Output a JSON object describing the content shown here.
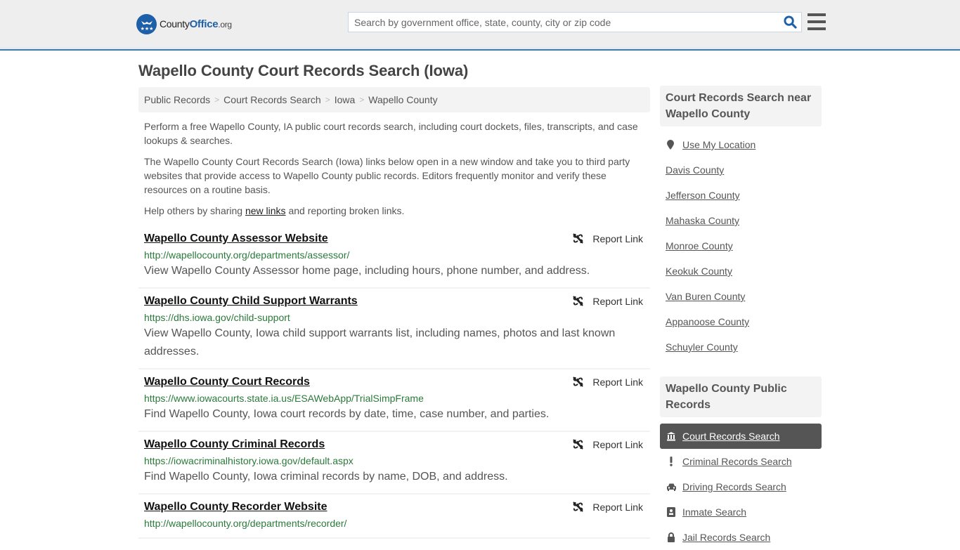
{
  "header": {
    "logo": {
      "name": "County",
      "brand": "Office",
      "tld": ".org"
    },
    "search": {
      "placeholder": "Search by government office, state, county, city or zip code",
      "value": ""
    },
    "icons": {
      "search": "search-icon",
      "menu": "hamburger-menu-icon"
    }
  },
  "page": {
    "title": "Wapello County Court Records Search (Iowa)"
  },
  "breadcrumb": [
    {
      "label": "Public Records"
    },
    {
      "label": "Court Records Search"
    },
    {
      "label": "Iowa"
    },
    {
      "label": "Wapello County"
    }
  ],
  "breadcrumb_separator": ">",
  "intro": {
    "p1": "Perform a free Wapello County, IA public court records search, including court dockets, files, transcripts, and case lookups & searches.",
    "p2": "The Wapello County Court Records Search (Iowa) links below open in a new window and take you to third party websites that provide access to Wapello County public records. Editors frequently monitor and verify these resources on a routine basis.",
    "p3_before": "Help others by sharing ",
    "p3_link": "new links",
    "p3_after": " and reporting broken links."
  },
  "links": [
    {
      "title": "Wapello County Assessor Website",
      "url": "http://wapellocounty.org/departments/assessor/",
      "description": "View Wapello County Assessor home page, including hours, phone number, and address.",
      "report_label": "Report Link"
    },
    {
      "title": "Wapello County Child Support Warrants",
      "url": "https://dhs.iowa.gov/child-support",
      "description": "View Wapello County, Iowa child support warrants list, including names, photos and last known addresses.",
      "report_label": "Report Link"
    },
    {
      "title": "Wapello County Court Records",
      "url": "https://www.iowacourts.state.ia.us/ESAWebApp/TrialSimpFrame",
      "description": "Find Wapello County, Iowa court records by date, time, case number, and parties.",
      "report_label": "Report Link"
    },
    {
      "title": "Wapello County Criminal Records",
      "url": "https://iowacriminalhistory.iowa.gov/default.aspx",
      "description": "Find Wapello County, Iowa criminal records by name, DOB, and address.",
      "report_label": "Report Link"
    },
    {
      "title": "Wapello County Recorder Website",
      "url": "http://wapellocounty.org/departments/recorder/",
      "description": "",
      "report_label": "Report Link"
    }
  ],
  "sidebar": {
    "nearby": {
      "heading": "Court Records Search near Wapello County",
      "use_location": "Use My Location",
      "counties": [
        "Davis County",
        "Jefferson County",
        "Mahaska County",
        "Monroe County",
        "Keokuk County",
        "Van Buren County",
        "Appanoose County",
        "Schuyler County"
      ]
    },
    "public_records": {
      "heading": "Wapello County Public Records",
      "items": [
        {
          "label": "Court Records Search",
          "icon": "courthouse-icon",
          "active": true
        },
        {
          "label": "Criminal Records Search",
          "icon": "exclamation-icon",
          "active": false
        },
        {
          "label": "Driving Records Search",
          "icon": "car-icon",
          "active": false
        },
        {
          "label": "Inmate Search",
          "icon": "id-badge-icon",
          "active": false
        },
        {
          "label": "Jail Records Search",
          "icon": "lock-icon",
          "active": false
        }
      ]
    }
  },
  "colors": {
    "brand_blue": "#1d5fa8",
    "header_border": "#3b7cac",
    "url_green": "#2a7a3a",
    "active_nav_bg": "#555555"
  }
}
